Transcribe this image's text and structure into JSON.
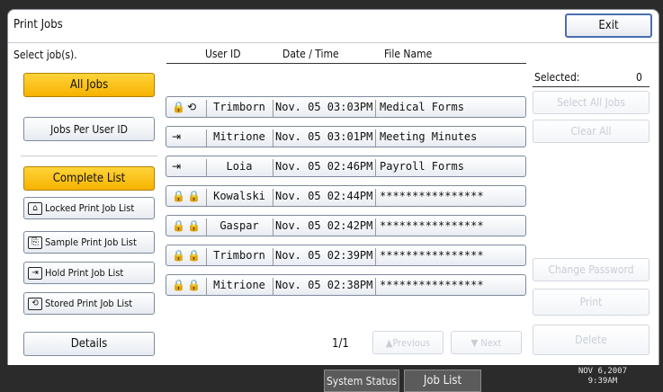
{
  "header": {
    "title": "Print Jobs",
    "exit_label": "Exit"
  },
  "instruction": "Select job(s).",
  "left_menu": {
    "all_jobs": "All Jobs",
    "jobs_per_user": "Jobs Per User ID",
    "complete_list": "Complete List",
    "locked": "Locked Print Job List",
    "sample": "Sample Print Job List",
    "hold": "Hold Print Job List",
    "stored": "Stored Print Job List",
    "details": "Details"
  },
  "columns": {
    "user": "User ID",
    "date": "Date / Time",
    "file": "File Name"
  },
  "jobs": [
    {
      "icon": "🔒⟲",
      "user": "Trimborn",
      "date": "Nov. 05 03:03PM",
      "file": "Medical Forms"
    },
    {
      "icon": "⇥",
      "user": "Mitrione",
      "date": "Nov. 05 03:01PM",
      "file": "Meeting Minutes"
    },
    {
      "icon": "⇥",
      "user": "Loia",
      "date": "Nov. 05 02:46PM",
      "file": "Payroll Forms"
    },
    {
      "icon": "🔒🔒",
      "user": "Kowalski",
      "date": "Nov. 05 02:44PM",
      "file": "****************"
    },
    {
      "icon": "🔒🔒",
      "user": "Gaspar",
      "date": "Nov. 05 02:42PM",
      "file": "****************"
    },
    {
      "icon": "🔒🔒",
      "user": "Trimborn",
      "date": "Nov. 05 02:39PM",
      "file": "****************"
    },
    {
      "icon": "🔒🔒",
      "user": "Mitrione",
      "date": "Nov. 05 02:38PM",
      "file": "****************"
    }
  ],
  "pagination": {
    "page": "1/1",
    "previous": "▲Previous",
    "next": "▼ Next"
  },
  "right_panel": {
    "selected_label": "Selected:",
    "selected_count": "0",
    "select_all": "Select All Jobs",
    "clear_all": "Clear All",
    "change_password": "Change Password",
    "print": "Print",
    "delete": "Delete"
  },
  "taskbar": {
    "system_status": "System Status",
    "job_list": "Job List",
    "date": "NOV   6,2007",
    "time": "9:39AM"
  }
}
